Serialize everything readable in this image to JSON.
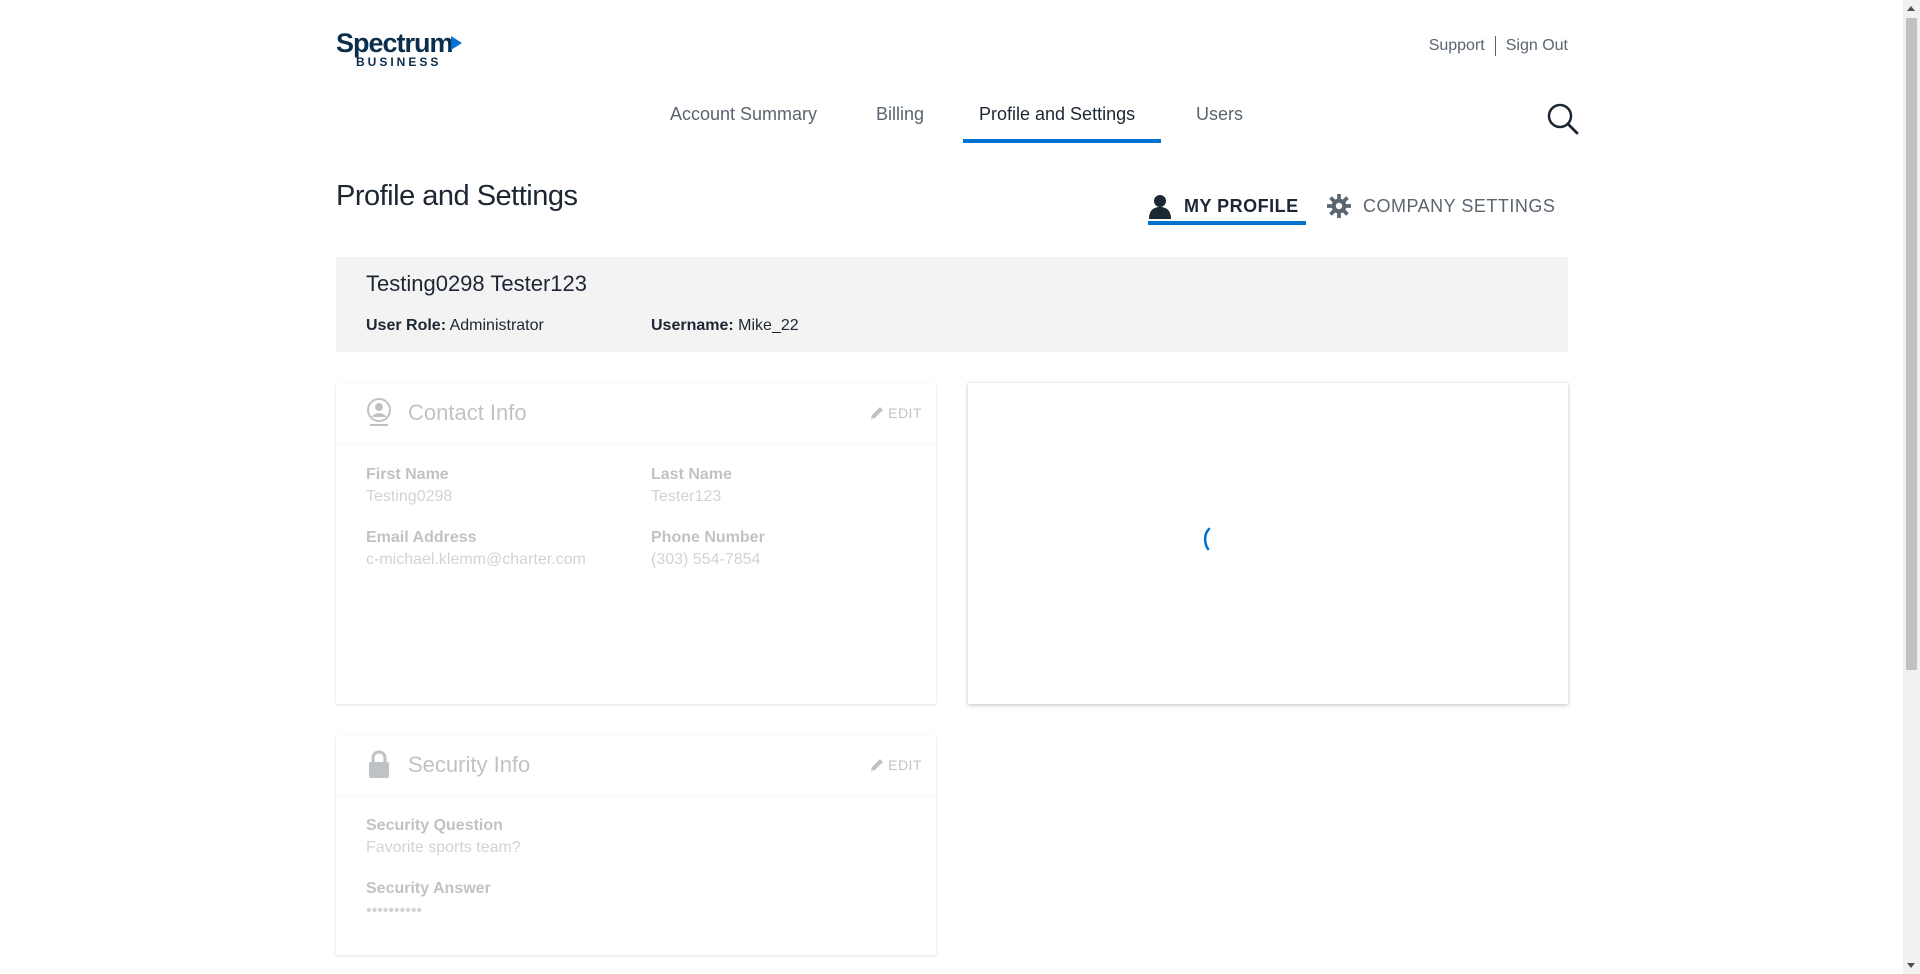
{
  "brand": {
    "name_top": "Spectrum",
    "name_bottom": "BUSINESS",
    "accent": "#0073d1",
    "dark": "#0a2e4b"
  },
  "header": {
    "support": "Support",
    "sign_out": "Sign Out"
  },
  "nav": {
    "items": [
      {
        "label": "Account Summary"
      },
      {
        "label": "Billing"
      },
      {
        "label": "Profile and Settings"
      },
      {
        "label": "Users"
      }
    ],
    "active": "Profile and Settings"
  },
  "page": {
    "title": "Profile and Settings",
    "tabs": {
      "my_profile": "MY PROFILE",
      "company_settings": "COMPANY SETTINGS"
    }
  },
  "profile": {
    "full_name": "Testing0298 Tester123",
    "role_label": "User Role:",
    "role_value": "Administrator",
    "username_label": "Username:",
    "username_value": "Mike_22"
  },
  "contact": {
    "title": "Contact Info",
    "edit": "EDIT",
    "first_name_label": "First Name",
    "first_name": "Testing0298",
    "last_name_label": "Last Name",
    "last_name": "Tester123",
    "email_label": "Email Address",
    "email": "c-michael.klemm@charter.com",
    "phone_label": "Phone Number",
    "phone": "(303) 554-7854"
  },
  "security": {
    "title": "Security Info",
    "edit": "EDIT",
    "question_label": "Security Question",
    "question": "Favorite sports team?",
    "answer_label": "Security Answer",
    "answer": "••••••••••"
  },
  "icons": {
    "search": "search-icon",
    "profile": "person-icon",
    "company": "gear-icon",
    "contact": "contact-icon",
    "security": "lock-icon",
    "edit": "pencil-icon",
    "loading": "loading-spinner-icon"
  }
}
